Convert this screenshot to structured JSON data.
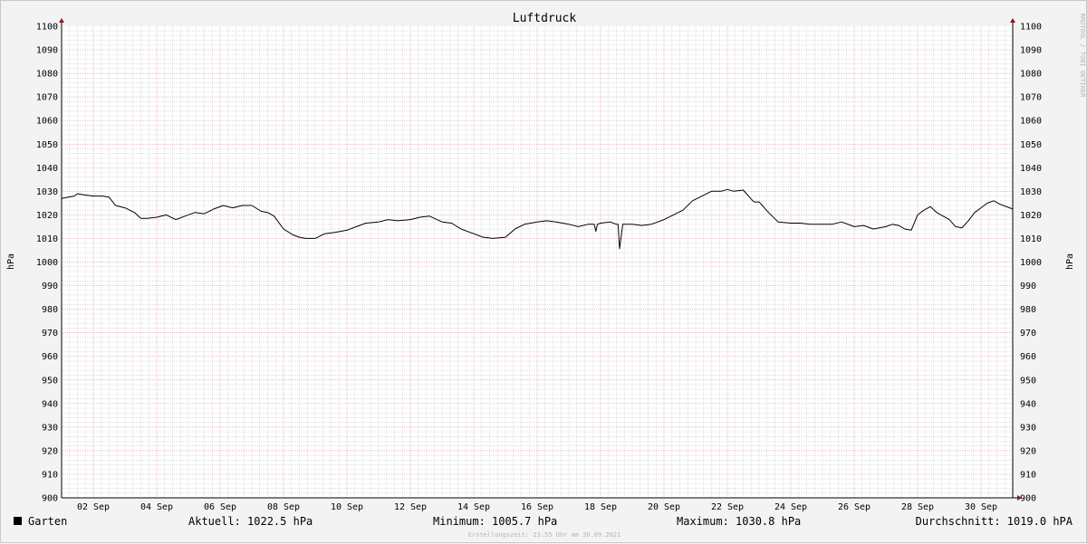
{
  "chart_data": {
    "type": "line",
    "title": "Luftdruck",
    "ylabel": "hPa",
    "ylabel_right": "hPa",
    "ylim": [
      900,
      1100
    ],
    "yticks": [
      900,
      910,
      920,
      930,
      940,
      950,
      960,
      970,
      980,
      990,
      1000,
      1010,
      1020,
      1030,
      1040,
      1050,
      1060,
      1070,
      1080,
      1090,
      1100
    ],
    "xlim": [
      1,
      31
    ],
    "x_tick_days": [
      2,
      4,
      6,
      8,
      10,
      12,
      14,
      16,
      18,
      20,
      22,
      24,
      26,
      28,
      30
    ],
    "x_tick_labels": [
      "02 Sep",
      "04 Sep",
      "06 Sep",
      "08 Sep",
      "10 Sep",
      "12 Sep",
      "14 Sep",
      "16 Sep",
      "18 Sep",
      "20 Sep",
      "22 Sep",
      "24 Sep",
      "26 Sep",
      "28 Sep",
      "30 Sep"
    ],
    "grid": true,
    "series": [
      {
        "name": "Garten",
        "color": "#000000",
        "x": [
          1,
          1.2,
          1.4,
          1.5,
          1.7,
          2,
          2.3,
          2.5,
          2.7,
          3,
          3.3,
          3.5,
          3.7,
          4,
          4.3,
          4.6,
          4.9,
          5.2,
          5.5,
          5.8,
          6.1,
          6.4,
          6.7,
          7,
          7.3,
          7.5,
          7.7,
          8,
          8.3,
          8.5,
          8.7,
          9,
          9.3,
          9.6,
          10,
          10.3,
          10.6,
          11,
          11.3,
          11.6,
          12,
          12.3,
          12.6,
          13,
          13.3,
          13.6,
          14,
          14.3,
          14.6,
          15,
          15.3,
          15.6,
          16,
          16.3,
          16.6,
          17,
          17.3,
          17.6,
          17.8,
          17.85,
          17.9,
          18,
          18.3,
          18.5,
          18.55,
          18.6,
          18.7,
          19,
          19.3,
          19.6,
          20,
          20.3,
          20.6,
          20.9,
          21.2,
          21.5,
          21.8,
          22,
          22.2,
          22.5,
          22.8,
          22.85,
          23,
          23.3,
          23.6,
          24,
          24.3,
          24.6,
          25,
          25.3,
          25.6,
          26,
          26.3,
          26.6,
          27,
          27.2,
          27.4,
          27.6,
          27.8,
          28,
          28.2,
          28.4,
          28.6,
          28.8,
          29,
          29.2,
          29.4,
          29.6,
          29.8,
          30,
          30.2,
          30.4,
          30.6,
          31
        ],
        "values": [
          1027,
          1027.5,
          1028,
          1029,
          1028.5,
          1028,
          1028,
          1027.5,
          1024,
          1023,
          1021,
          1018.5,
          1018.5,
          1019,
          1020,
          1018,
          1019.5,
          1021,
          1020.5,
          1022.5,
          1024,
          1023,
          1024,
          1024,
          1021.5,
          1021,
          1019.5,
          1014,
          1011.5,
          1010.5,
          1010,
          1010,
          1012,
          1012.5,
          1013.5,
          1015,
          1016.5,
          1017,
          1018,
          1017.5,
          1018,
          1019,
          1019.5,
          1017,
          1016.5,
          1014,
          1012,
          1010.5,
          1010,
          1010.5,
          1014,
          1016,
          1017,
          1017.5,
          1017,
          1016,
          1015,
          1016,
          1016,
          1013,
          1016,
          1016.5,
          1017,
          1016,
          1016,
          1005.7,
          1016,
          1016,
          1015.5,
          1016,
          1018,
          1020,
          1022,
          1026,
          1028,
          1030,
          1030,
          1030.8,
          1030,
          1030.5,
          1026,
          1025.5,
          1025.5,
          1021,
          1017,
          1016.5,
          1016.5,
          1016,
          1016,
          1016,
          1017,
          1015,
          1015.5,
          1014,
          1015,
          1016,
          1015.5,
          1014,
          1013.5,
          1020,
          1022,
          1023.5,
          1021,
          1019.5,
          1018,
          1015,
          1014.5,
          1017.5,
          1021,
          1023,
          1025,
          1026,
          1024.5,
          1022.5
        ]
      }
    ]
  },
  "legend": {
    "series_name": "Garten",
    "swatch_color": "#000000"
  },
  "stats": {
    "current": "Aktuell: 1022.5 hPa",
    "minimum": "Minimum: 1005.7 hPa",
    "maximum": "Maximum: 1030.8 hPa",
    "average": "Durchschnitt: 1019.0 hPA"
  },
  "footer": {
    "created": "Erstellungszeit: 23:55 Uhr am 30.09.2021"
  },
  "watermark": "RRDTOOL / TOBI OETIKER",
  "colors": {
    "background": "#f3f3f3",
    "plot_background": "#ffffff",
    "major_grid": "#e8a0a0",
    "minor_grid": "#cccccc",
    "arrow": "#8b1a1a"
  }
}
